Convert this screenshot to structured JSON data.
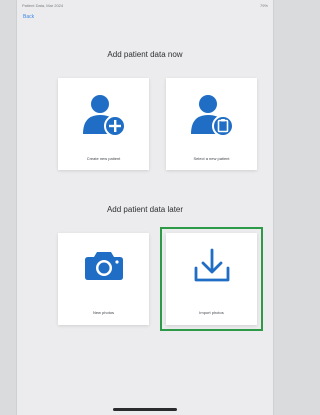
{
  "status_bar": {
    "left_text": "Patient Data, Mar 2024",
    "right_text": "79%"
  },
  "nav": {
    "back_label": "Back"
  },
  "now_section": {
    "title": "Add patient data now",
    "cards": [
      {
        "label": "Create new patient",
        "icon": "add-patient-icon"
      },
      {
        "label": "Select a new patient",
        "icon": "select-patient-icon"
      }
    ]
  },
  "later_section": {
    "title": "Add patient data later",
    "cards": [
      {
        "label": "New photos",
        "icon": "camera-icon"
      },
      {
        "label": "Import photos",
        "icon": "download-icon",
        "selected": true
      }
    ]
  },
  "colors": {
    "accent_blue": "#1f6dc4",
    "selection_green": "#2d9a48"
  }
}
